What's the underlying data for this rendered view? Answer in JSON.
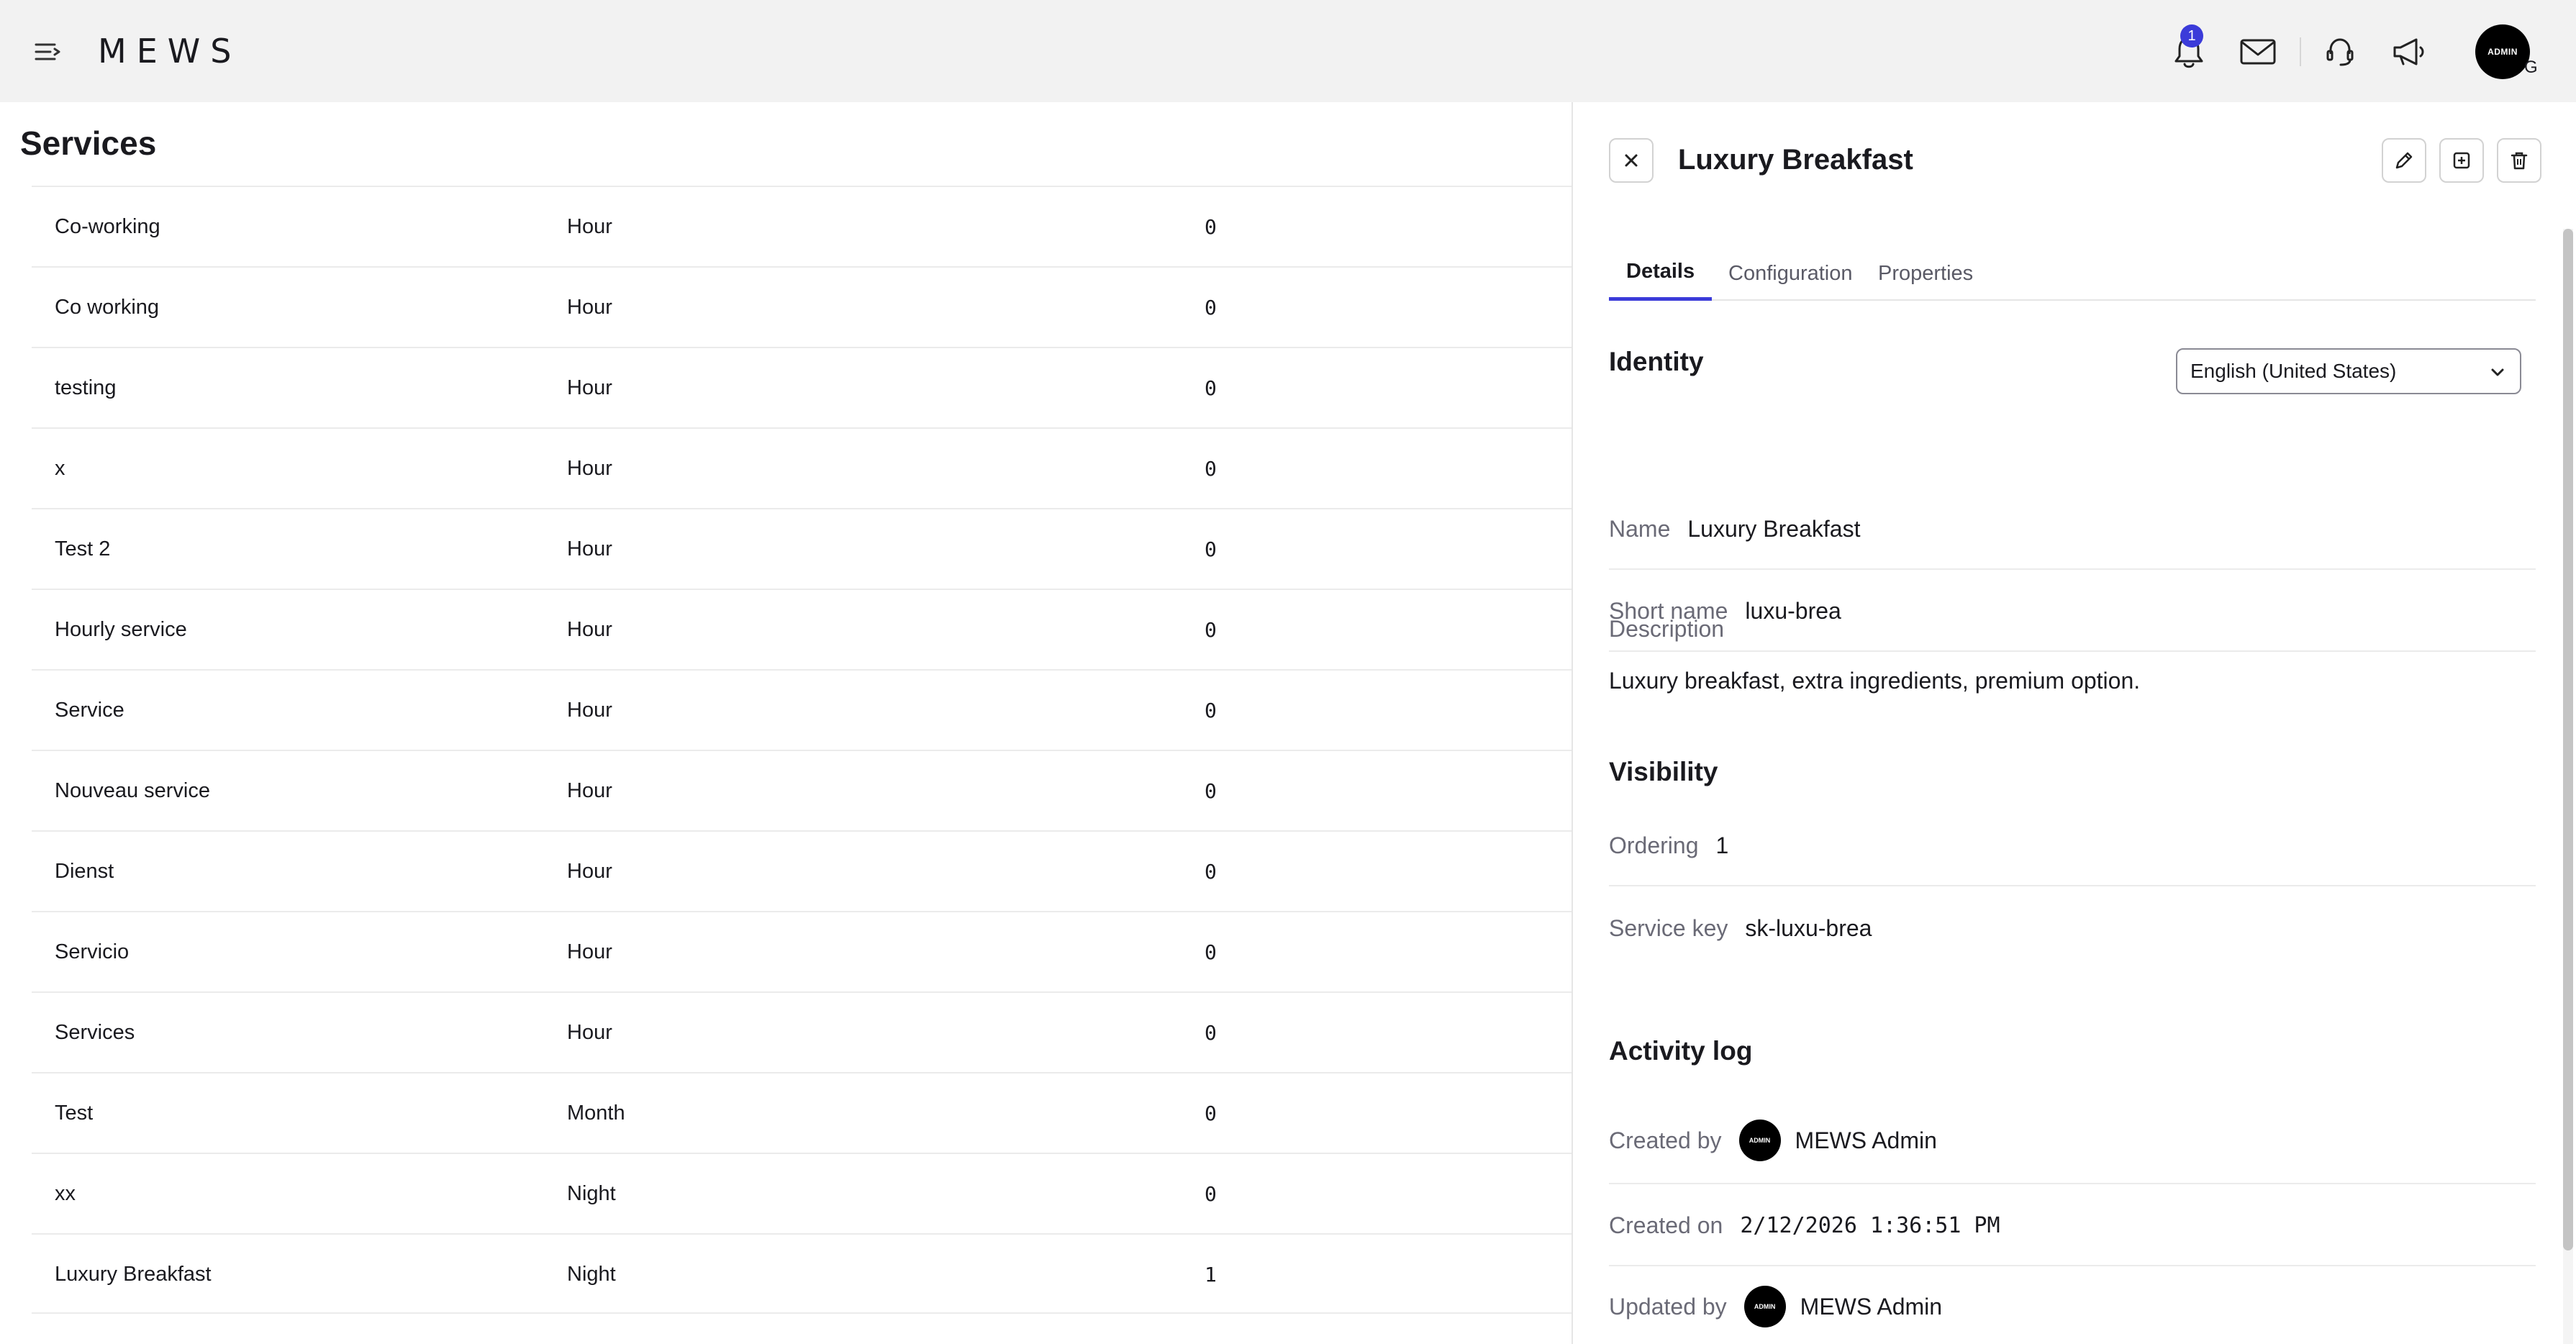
{
  "topbar": {
    "logo": "MEWS",
    "notification_count": "1",
    "avatar_label": "ADMIN",
    "avatar_suffix": "G"
  },
  "services": {
    "title": "Services",
    "rows": [
      {
        "name": "Co-working",
        "unit": "Hour",
        "value": "0"
      },
      {
        "name": "Co working",
        "unit": "Hour",
        "value": "0"
      },
      {
        "name": "testing",
        "unit": "Hour",
        "value": "0"
      },
      {
        "name": "x",
        "unit": "Hour",
        "value": "0"
      },
      {
        "name": "Test 2",
        "unit": "Hour",
        "value": "0"
      },
      {
        "name": "Hourly service",
        "unit": "Hour",
        "value": "0"
      },
      {
        "name": "Service",
        "unit": "Hour",
        "value": "0"
      },
      {
        "name": "Nouveau service",
        "unit": "Hour",
        "value": "0"
      },
      {
        "name": "Dienst",
        "unit": "Hour",
        "value": "0"
      },
      {
        "name": "Servicio",
        "unit": "Hour",
        "value": "0"
      },
      {
        "name": "Services",
        "unit": "Hour",
        "value": "0"
      },
      {
        "name": "Test",
        "unit": "Month",
        "value": "0"
      },
      {
        "name": "xx",
        "unit": "Night",
        "value": "0"
      },
      {
        "name": "Luxury Breakfast",
        "unit": "Night",
        "value": "1"
      }
    ]
  },
  "panel": {
    "title": "Luxury Breakfast",
    "tabs": [
      {
        "label": "Details",
        "active": true
      },
      {
        "label": "Configuration",
        "active": false
      },
      {
        "label": "Properties",
        "active": false
      }
    ],
    "identity": {
      "heading": "Identity",
      "language": "English (United States)",
      "name_label": "Name",
      "name_value": "Luxury Breakfast",
      "short_name_label": "Short name",
      "short_name_value": "luxu-brea",
      "description_label": "Description",
      "description_value": "Luxury breakfast, extra ingredients, premium option."
    },
    "visibility": {
      "heading": "Visibility",
      "ordering_label": "Ordering",
      "ordering_value": "1",
      "service_key_label": "Service key",
      "service_key_value": "sk-luxu-brea"
    },
    "activity": {
      "heading": "Activity log",
      "created_by_label": "Created by",
      "created_by_value": "MEWS Admin",
      "created_on_label": "Created on",
      "created_on_value": "2/12/2026 1:36:51 PM",
      "updated_by_label": "Updated by",
      "updated_by_value": "MEWS Admin",
      "avatar_label": "ADMIN"
    }
  },
  "colors": {
    "accent": "#3b3bd9",
    "topbar_bg": "#f2f2f2"
  }
}
